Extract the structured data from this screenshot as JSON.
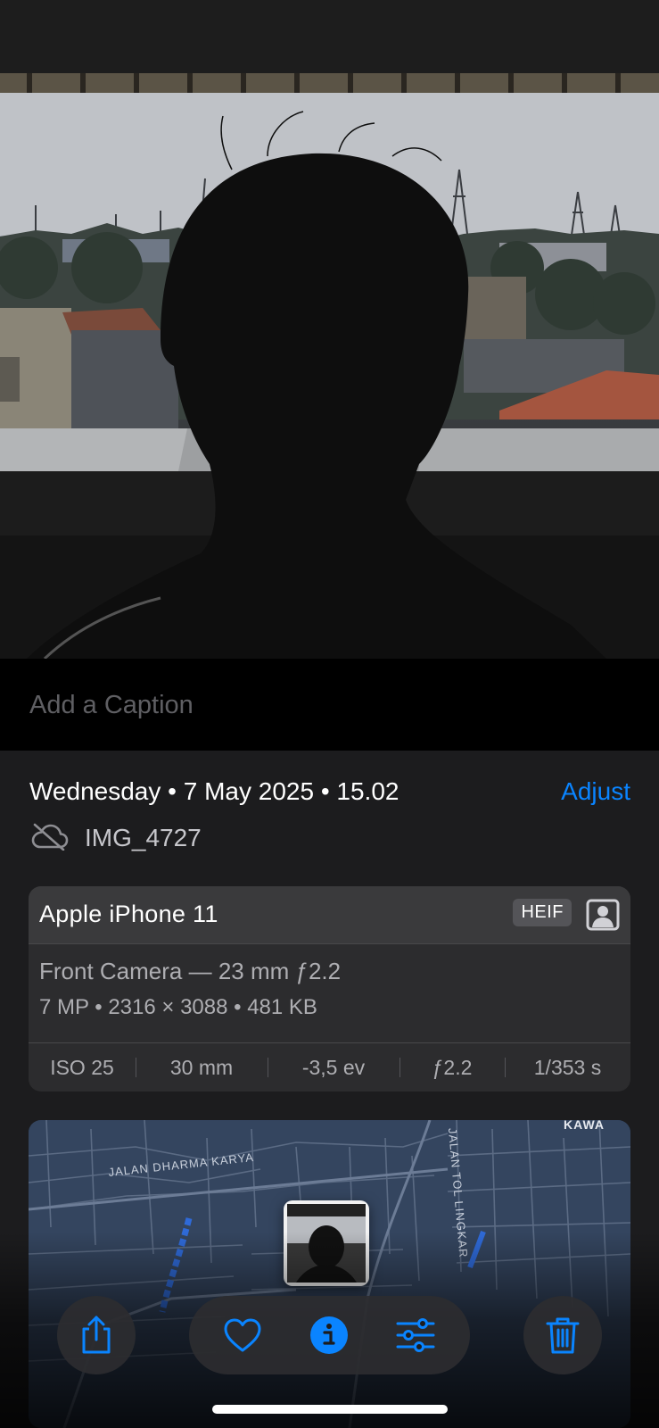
{
  "caption": {
    "placeholder": "Add a Caption"
  },
  "info": {
    "date": "Wednesday • 7 May 2025 • 15.02",
    "adjust_label": "Adjust",
    "filename": "IMG_4727",
    "cloud_icon": "cloud-slash-icon"
  },
  "exif": {
    "device": "Apple iPhone 11",
    "format_badge": "HEIF",
    "portrait_icon": "portrait-person-icon",
    "lens": "Front Camera — 23 mm ƒ2.2",
    "specs": "7 MP  •  2316 × 3088  •  481 KB",
    "details": [
      "ISO 25",
      "30 mm",
      "-3,5 ev",
      "ƒ2.2",
      "1/353 s"
    ]
  },
  "map": {
    "street_labels": [
      "JALAN DHARMA KARYA",
      "JALAN TOL LINGKAR",
      "KAWA"
    ]
  },
  "toolbar": {
    "buttons": [
      "share-icon",
      "heart-icon",
      "info-icon",
      "sliders-icon",
      "trash-icon"
    ],
    "accent_color": "#0a84ff"
  }
}
